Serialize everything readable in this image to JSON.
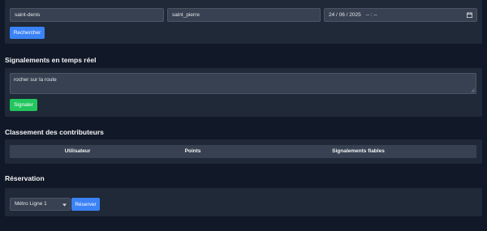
{
  "search": {
    "from_value": "saint-denis",
    "to_value": "saint_pierre",
    "date_value": "24 / 06 / 2025",
    "time_value": "-- : --",
    "button_label": "Rechercher"
  },
  "reports": {
    "title": "Signalements en temps réel",
    "message_value": "rocher sur la route",
    "button_label": "Signaler"
  },
  "leaderboard": {
    "title": "Classement des contributeurs",
    "columns": [
      "Utilisateur",
      "Points",
      "Signalements fiables"
    ]
  },
  "reservation": {
    "title": "Réservation",
    "selected_line": "Métro Ligne 1",
    "button_label": "Réserver"
  },
  "colors": {
    "background": "#111827",
    "panel": "#1f2937",
    "input": "#374151",
    "primary": "#3b82f6",
    "success": "#22c55e"
  }
}
